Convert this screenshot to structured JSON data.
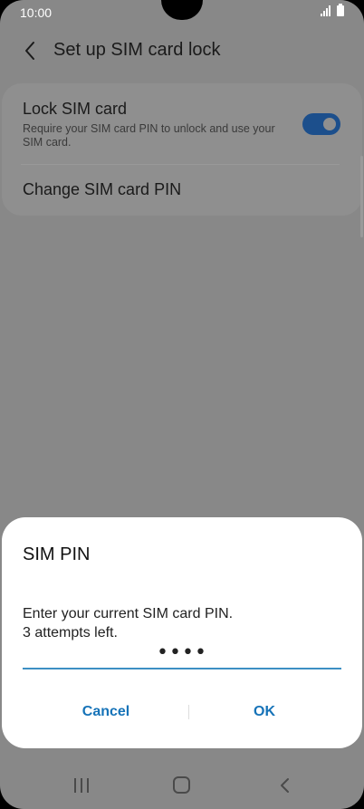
{
  "status_bar": {
    "time": "10:00"
  },
  "header": {
    "title": "Set up SIM card lock"
  },
  "settings": {
    "lock_sim": {
      "title": "Lock SIM card",
      "description": "Require your SIM card PIN to unlock and use your SIM card.",
      "enabled": true
    },
    "change_pin": {
      "title": "Change SIM card PIN"
    }
  },
  "dialog": {
    "title": "SIM PIN",
    "message_line1": "Enter your current SIM card PIN.",
    "message_line2": "3 attempts left.",
    "pin_value": "••••",
    "cancel_label": "Cancel",
    "ok_label": "OK"
  },
  "colors": {
    "accent": "#1673b8",
    "toggle_on": "#1c4f8c",
    "scrim": "#888888"
  }
}
